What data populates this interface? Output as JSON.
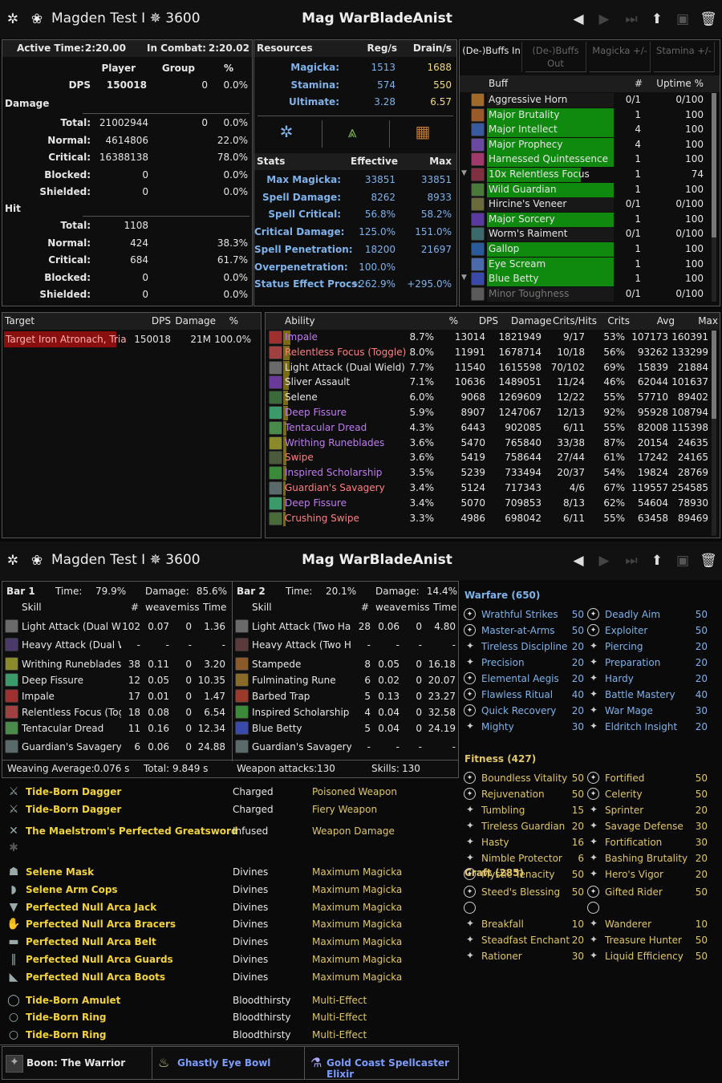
{
  "header": {
    "char_name": "Magden Test I",
    "cp": "3600",
    "title": "Mag WarBladeAnist"
  },
  "fight": {
    "active_label": "Active Time:",
    "active": "2:20.00",
    "combat_label": "In Combat:",
    "combat": "2:20.02",
    "col_player": "Player",
    "col_group": "Group",
    "col_pct": "%",
    "dps_label": "DPS",
    "dps_player": "150018",
    "dps_group": "0",
    "dps_pct": "0.0%",
    "damage_label": "Damage",
    "damage_rows": [
      {
        "l": "Total:",
        "p": "21002944",
        "g": "0",
        "pct": "0.0%"
      },
      {
        "l": "Normal:",
        "p": "4614806",
        "g": "",
        "pct": "22.0%"
      },
      {
        "l": "Critical:",
        "p": "16388138",
        "g": "",
        "pct": "78.0%"
      },
      {
        "l": "Blocked:",
        "p": "0",
        "g": "",
        "pct": "0.0%"
      },
      {
        "l": "Shielded:",
        "p": "0",
        "g": "",
        "pct": "0.0%"
      }
    ],
    "hit_label": "Hit",
    "hit_rows": [
      {
        "l": "Total:",
        "p": "1108",
        "pct": ""
      },
      {
        "l": "Normal:",
        "p": "424",
        "pct": "38.3%"
      },
      {
        "l": "Critical:",
        "p": "684",
        "pct": "61.7%"
      },
      {
        "l": "Blocked:",
        "p": "0",
        "pct": "0.0%"
      },
      {
        "l": "Shielded:",
        "p": "0",
        "pct": "0.0%"
      }
    ]
  },
  "resources": {
    "title": "Resources",
    "col_reg": "Reg/s",
    "col_drain": "Drain/s",
    "rows": [
      {
        "l": "Magicka:",
        "reg": "1513",
        "drain": "1688"
      },
      {
        "l": "Stamina:",
        "reg": "574",
        "drain": "550"
      },
      {
        "l": "Ultimate:",
        "reg": "3.28",
        "drain": "6.57"
      }
    ],
    "stats_title": "Stats",
    "col_eff": "Effective",
    "col_max": "Max",
    "stats": [
      {
        "l": "Max Magicka:",
        "e": "33851",
        "m": "33851"
      },
      {
        "l": "Spell Damage:",
        "e": "8262",
        "m": "8933"
      },
      {
        "l": "Spell Critical:",
        "e": "56.8%",
        "m": "58.2%"
      },
      {
        "l": "Critical Damage:",
        "e": "125.0%",
        "m": "151.0%"
      },
      {
        "l": "Spell Penetration:",
        "e": "18200",
        "m": "21697"
      },
      {
        "l": "Overpenetration:",
        "e": "100.0%",
        "m": ""
      },
      {
        "l": "Status Effect Procs:",
        "e": "+262.9%",
        "m": "+295.0%"
      }
    ]
  },
  "buffs": {
    "tabs": [
      "(De-)Buffs In",
      "(De-)Buffs Out",
      "Magicka +/-",
      "Stamina +/-"
    ],
    "col_buff": "Buff",
    "col_count": "#",
    "col_uptime": "Uptime %",
    "rows": [
      {
        "n": "Aggressive Horn",
        "c": "0/1",
        "u": "0/100",
        "w": 0,
        "ic": "#a06a2a"
      },
      {
        "n": "Major Brutality",
        "c": "1",
        "u": "100",
        "w": 1,
        "ic": "#9a5a2a"
      },
      {
        "n": "Major Intellect",
        "c": "4",
        "u": "100",
        "w": 1,
        "ic": "#3a5aa0"
      },
      {
        "n": "Major Prophecy",
        "c": "4",
        "u": "100",
        "w": 1,
        "ic": "#6a4aa0"
      },
      {
        "n": "Harnessed Quintessence",
        "c": "1",
        "u": "100",
        "w": 1,
        "ic": "#a03a6a"
      },
      {
        "n": "10x Relentless Focus",
        "c": "1",
        "u": "74",
        "w": 0.74,
        "ic": "#803040"
      },
      {
        "n": "Wild Guardian",
        "c": "1",
        "u": "100",
        "w": 1,
        "ic": "#4a7a3a"
      },
      {
        "n": "Hircine's Veneer",
        "c": "0/1",
        "u": "0/100",
        "w": 0,
        "ic": "#6a6a3a"
      },
      {
        "n": "Major Sorcery",
        "c": "1",
        "u": "100",
        "w": 1,
        "ic": "#5a3aa0"
      },
      {
        "n": "Worm's Raiment",
        "c": "0/1",
        "u": "0/100",
        "w": 0,
        "ic": "#3a6a6a"
      },
      {
        "n": "Gallop",
        "c": "1",
        "u": "100",
        "w": 1,
        "ic": "#2a5a9a"
      },
      {
        "n": "Eye Scream",
        "c": "1",
        "u": "100",
        "w": 1,
        "ic": "#4a6aaa"
      },
      {
        "n": "Blue Betty",
        "c": "1",
        "u": "100",
        "w": 1,
        "ic": "#3a4aaa"
      },
      {
        "n": "Minor Toughness",
        "c": "0/1",
        "u": "0/100",
        "w": 0,
        "ic": "#5a5a5a"
      }
    ]
  },
  "target": {
    "col_target": "Target",
    "col_dps": "DPS",
    "col_damage": "Damage",
    "col_pct": "%",
    "name": "Target Iron Atronach, Tria",
    "dps": "150018",
    "damage": "21M",
    "pct": "100.0%"
  },
  "abilities": {
    "cols": [
      "Ability",
      "%",
      "DPS",
      "Damage",
      "Crits/Hits",
      "Crits",
      "Avg",
      "Max"
    ],
    "rows": [
      {
        "n": "Impale",
        "p": "8.7%",
        "d": "13014",
        "dmg": "1821949",
        "ch": "9/17",
        "cr": "53%",
        "a": "107173",
        "m": "160391",
        "c": "#c07cf0",
        "bar": 0.087,
        "ic": "#a03030"
      },
      {
        "n": "Relentless Focus (Toggle)",
        "p": "8.0%",
        "d": "11991",
        "dmg": "1678714",
        "ch": "10/18",
        "cr": "56%",
        "a": "93262",
        "m": "133299",
        "c": "#ff8080",
        "bar": 0.08,
        "ic": "#a04040"
      },
      {
        "n": "Light Attack (Dual Wield)",
        "p": "7.7%",
        "d": "11540",
        "dmg": "1615598",
        "ch": "70/102",
        "cr": "69%",
        "a": "15839",
        "m": "21884",
        "c": "#e6e6e6",
        "bar": 0.077,
        "ic": "#6a6a6a"
      },
      {
        "n": "Sliver Assault",
        "p": "7.1%",
        "d": "10636",
        "dmg": "1489051",
        "ch": "11/24",
        "cr": "46%",
        "a": "62044",
        "m": "101637",
        "c": "#e6e6e6",
        "bar": 0.071,
        "ic": "#6a3a9a"
      },
      {
        "n": "Selene",
        "p": "6.0%",
        "d": "9068",
        "dmg": "1269609",
        "ch": "12/22",
        "cr": "55%",
        "a": "57710",
        "m": "89402",
        "c": "#e6e6e6",
        "bar": 0.06,
        "ic": "#3a6a3a"
      },
      {
        "n": "Deep Fissure",
        "p": "5.9%",
        "d": "8907",
        "dmg": "1247067",
        "ch": "12/13",
        "cr": "92%",
        "a": "95928",
        "m": "108794",
        "c": "#c07cf0",
        "bar": 0.059,
        "ic": "#3a9a6a"
      },
      {
        "n": "Tentacular Dread",
        "p": "4.3%",
        "d": "6443",
        "dmg": "902085",
        "ch": "6/11",
        "cr": "55%",
        "a": "82008",
        "m": "115398",
        "c": "#c07cf0",
        "bar": 0.043,
        "ic": "#4a8a4a"
      },
      {
        "n": "Writhing Runeblades",
        "p": "3.6%",
        "d": "5470",
        "dmg": "765840",
        "ch": "33/38",
        "cr": "87%",
        "a": "20154",
        "m": "24635",
        "c": "#c07cf0",
        "bar": 0.036,
        "ic": "#8a8a2a"
      },
      {
        "n": "Swipe",
        "p": "3.6%",
        "d": "5419",
        "dmg": "758644",
        "ch": "27/44",
        "cr": "61%",
        "a": "17242",
        "m": "24165",
        "c": "#ff8080",
        "bar": 0.036,
        "ic": "#4a5a3a"
      },
      {
        "n": "Inspired Scholarship",
        "p": "3.5%",
        "d": "5239",
        "dmg": "733494",
        "ch": "20/37",
        "cr": "54%",
        "a": "19824",
        "m": "28769",
        "c": "#c07cf0",
        "bar": 0.035,
        "ic": "#3a8a3a"
      },
      {
        "n": "Guardian's Savagery",
        "p": "3.4%",
        "d": "5124",
        "dmg": "717343",
        "ch": "4/6",
        "cr": "67%",
        "a": "119557",
        "m": "254585",
        "c": "#ff8080",
        "bar": 0.034,
        "ic": "#5a6a6a"
      },
      {
        "n": "Deep Fissure",
        "p": "3.4%",
        "d": "5070",
        "dmg": "709853",
        "ch": "8/13",
        "cr": "62%",
        "a": "54604",
        "m": "78930",
        "c": "#c07cf0",
        "bar": 0.034,
        "ic": "#3a9a6a"
      },
      {
        "n": "Crushing Swipe",
        "p": "3.3%",
        "d": "4986",
        "dmg": "698042",
        "ch": "6/11",
        "cr": "55%",
        "a": "63458",
        "m": "89469",
        "c": "#ff8080",
        "bar": 0.033,
        "ic": "#4a6a3a"
      }
    ]
  },
  "header2": {
    "char_name": "Magden Test I",
    "cp": "3600",
    "title": "Mag WarBladeAnist"
  },
  "skillbars": [
    {
      "bar": "Bar 1",
      "time_label": "Time:",
      "time": "79.9%",
      "damage_label": "Damage:",
      "damage": "85.6%",
      "col_skill": "Skill",
      "col_count": "#",
      "col_weave": "weave",
      "col_miss": "miss",
      "col_time": "Time",
      "rows": [
        {
          "n": "Light Attack (Dual Wiel",
          "c": "102",
          "w": "0.07",
          "m": "0",
          "t": "1.36",
          "ic": "#6a6a6a"
        },
        {
          "n": "Heavy Attack (Dual Wi",
          "c": "-",
          "w": "-",
          "m": "-",
          "t": "-",
          "ic": "#4a3a6a"
        },
        {
          "n": "Writhing Runeblades",
          "c": "38",
          "w": "0.11",
          "m": "0",
          "t": "3.20",
          "ic": "#8a8a2a"
        },
        {
          "n": "Deep Fissure",
          "c": "12",
          "w": "0.05",
          "m": "0",
          "t": "10.35",
          "ic": "#3a9a6a"
        },
        {
          "n": "Impale",
          "c": "17",
          "w": "0.01",
          "m": "0",
          "t": "1.47",
          "ic": "#a03030"
        },
        {
          "n": "Relentless Focus (Tog",
          "c": "18",
          "w": "0.08",
          "m": "0",
          "t": "6.54",
          "ic": "#a04040"
        },
        {
          "n": "Tentacular Dread",
          "c": "11",
          "w": "0.16",
          "m": "0",
          "t": "12.34",
          "ic": "#4a8a4a"
        },
        {
          "n": "Guardian's Savagery",
          "c": "6",
          "w": "0.06",
          "m": "0",
          "t": "24.88",
          "ic": "#5a6a6a"
        }
      ]
    },
    {
      "bar": "Bar 2",
      "time_label": "Time:",
      "time": "20.1%",
      "damage_label": "Damage:",
      "damage": "14.4%",
      "col_skill": "Skill",
      "col_count": "#",
      "col_weave": "weave",
      "col_miss": "miss",
      "col_time": "Time",
      "rows": [
        {
          "n": "Light Attack (Two Han",
          "c": "28",
          "w": "0.06",
          "m": "0",
          "t": "4.80",
          "ic": "#6a6a6a"
        },
        {
          "n": "Heavy Attack (Two Ha",
          "c": "-",
          "w": "-",
          "m": "-",
          "t": "-",
          "ic": "#5a3a3a"
        },
        {
          "n": "Stampede",
          "c": "8",
          "w": "0.05",
          "m": "0",
          "t": "16.18",
          "ic": "#8a5a2a"
        },
        {
          "n": "Fulminating Rune",
          "c": "6",
          "w": "0.02",
          "m": "0",
          "t": "20.07",
          "ic": "#8a6a2a"
        },
        {
          "n": "Barbed Trap",
          "c": "5",
          "w": "0.13",
          "m": "0",
          "t": "23.27",
          "ic": "#9a3a2a"
        },
        {
          "n": "Inspired Scholarship",
          "c": "4",
          "w": "0.04",
          "m": "0",
          "t": "32.58",
          "ic": "#3a8a3a"
        },
        {
          "n": "Blue Betty",
          "c": "5",
          "w": "0.04",
          "m": "0",
          "t": "24.19",
          "ic": "#3a4aaa"
        },
        {
          "n": "Guardian's Savagery",
          "c": "-",
          "w": "-",
          "m": "-",
          "t": "-",
          "ic": "#5a6a6a"
        }
      ]
    }
  ],
  "weaving": {
    "avg_label": "Weaving Average:",
    "avg": "0.076 s",
    "total_label": "Total:",
    "total": "9.849 s",
    "attacks_label": "Weapon attacks:",
    "attacks": "130",
    "skills_label": "Skills:",
    "skills": "130"
  },
  "gear": [
    {
      "n": "Tide-Born Dagger",
      "t": "Charged",
      "e": "Poisoned Weapon",
      "gy": 984,
      "icon": "dagger-icon",
      "g": "⚔"
    },
    {
      "n": "Tide-Born Dagger",
      "t": "Charged",
      "e": "Fiery Weapon",
      "gy": 1006,
      "icon": "dagger-icon",
      "g": "⚔"
    },
    {
      "n": "The Maelstrom's Perfected Greatsword",
      "t": "Infused",
      "e": "Weapon Damage",
      "gy": 1033,
      "icon": "greatsword-icon",
      "g": "✕"
    },
    {
      "n": "Selene Mask",
      "t": "Divines",
      "e": "Maximum Magicka",
      "gy": 1084,
      "icon": "helmet-icon",
      "g": "☗"
    },
    {
      "n": "Selene Arm Cops",
      "t": "Divines",
      "e": "Maximum Magicka",
      "gy": 1106,
      "icon": "shoulder-icon",
      "g": "◗"
    },
    {
      "n": "Perfected Null Arca Jack",
      "t": "Divines",
      "e": "Maximum Magicka",
      "gy": 1128,
      "icon": "chest-icon",
      "g": "▼"
    },
    {
      "n": "Perfected Null Arca Bracers",
      "t": "Divines",
      "e": "Maximum Magicka",
      "gy": 1149,
      "icon": "gloves-icon",
      "g": "✋"
    },
    {
      "n": "Perfected Null Arca Belt",
      "t": "Divines",
      "e": "Maximum Magicka",
      "gy": 1171,
      "icon": "belt-icon",
      "g": "▬"
    },
    {
      "n": "Perfected Null Arca Guards",
      "t": "Divines",
      "e": "Maximum Magicka",
      "gy": 1193,
      "icon": "legs-icon",
      "g": "‖"
    },
    {
      "n": "Perfected Null Arca Boots",
      "t": "Divines",
      "e": "Maximum Magicka",
      "gy": 1215,
      "icon": "boots-icon",
      "g": "◣"
    },
    {
      "n": "Tide-Born Amulet",
      "t": "Bloodthirsty",
      "e": "Multi-Effect",
      "gy": 1244,
      "icon": "amulet-icon",
      "g": "◯"
    },
    {
      "n": "Tide-Born Ring",
      "t": "Bloodthirsty",
      "e": "Multi-Effect",
      "gy": 1265,
      "icon": "ring-icon",
      "g": "○"
    },
    {
      "n": "Tide-Born Ring",
      "t": "Bloodthirsty",
      "e": "Multi-Effect",
      "gy": 1287,
      "icon": "ring-icon",
      "g": "○"
    }
  ],
  "footer": {
    "boon": "Boon: The Warrior",
    "food": "Ghastly Eye Bowl",
    "drink": "Gold Coast Spellcaster Elixir"
  },
  "cp": {
    "warfare": {
      "title": "Warfare (650)",
      "left": [
        {
          "n": "Wrathful Strikes",
          "v": "50",
          "slot": true
        },
        {
          "n": "Master-at-Arms",
          "v": "50",
          "slot": true
        },
        {
          "n": "Tireless Discipline",
          "v": "20"
        },
        {
          "n": "Precision",
          "v": "20"
        },
        {
          "n": "Elemental Aegis",
          "v": "20",
          "slot": true
        },
        {
          "n": "Flawless Ritual",
          "v": "40",
          "slot": true
        },
        {
          "n": "Quick Recovery",
          "v": "20",
          "slot": true
        },
        {
          "n": "Mighty",
          "v": "30"
        }
      ],
      "right": [
        {
          "n": "Deadly Aim",
          "v": "50",
          "slot": true
        },
        {
          "n": "Exploiter",
          "v": "50",
          "slot": true
        },
        {
          "n": "Piercing",
          "v": "20"
        },
        {
          "n": "Preparation",
          "v": "20"
        },
        {
          "n": "Hardy",
          "v": "20"
        },
        {
          "n": "Battle Mastery",
          "v": "40"
        },
        {
          "n": "War Mage",
          "v": "30"
        },
        {
          "n": "Eldritch Insight",
          "v": "20"
        }
      ]
    },
    "fitness": {
      "title": "Fitness (427)",
      "left": [
        {
          "n": "Boundless Vitality",
          "v": "50",
          "slot": true
        },
        {
          "n": "Rejuvenation",
          "v": "50",
          "slot": true
        },
        {
          "n": "Tumbling",
          "v": "15"
        },
        {
          "n": "Tireless Guardian",
          "v": "20"
        },
        {
          "n": "Hasty",
          "v": "16"
        },
        {
          "n": "Nimble Protector",
          "v": "6"
        },
        {
          "n": "Mystic Tenacity",
          "v": "50",
          "slot": true
        }
      ],
      "right": [
        {
          "n": "Fortified",
          "v": "50",
          "slot": true
        },
        {
          "n": "Celerity",
          "v": "50",
          "slot": true
        },
        {
          "n": "Sprinter",
          "v": "20"
        },
        {
          "n": "Savage Defense",
          "v": "30"
        },
        {
          "n": "Fortification",
          "v": "30"
        },
        {
          "n": "Bashing Brutality",
          "v": "20"
        },
        {
          "n": "Hero's Vigor",
          "v": "20"
        }
      ]
    },
    "craft": {
      "title": "Craft (285)",
      "left": [
        {
          "n": "Steed's Blessing",
          "v": "50",
          "slot": true
        },
        {
          "n": "",
          "v": "",
          "slot": true,
          "empty": true
        },
        {
          "n": "Breakfall",
          "v": "10"
        },
        {
          "n": "Steadfast Enchant",
          "v": "20"
        },
        {
          "n": "Rationer",
          "v": "30"
        }
      ],
      "right": [
        {
          "n": "Gifted Rider",
          "v": "50",
          "slot": true
        },
        {
          "n": "",
          "v": "",
          "slot": true,
          "empty": true
        },
        {
          "n": "Wanderer",
          "v": "10"
        },
        {
          "n": "Treasure Hunter",
          "v": "50"
        },
        {
          "n": "Liquid Efficiency",
          "v": "50"
        }
      ]
    }
  },
  "colors": {
    "buff_bar": "#0f8a0f",
    "ability_bar": "#7a6a10",
    "accent_gold": "#f2d33a",
    "cp_blue": "#7fb2ea",
    "cp_yellow": "#e0c66a"
  }
}
